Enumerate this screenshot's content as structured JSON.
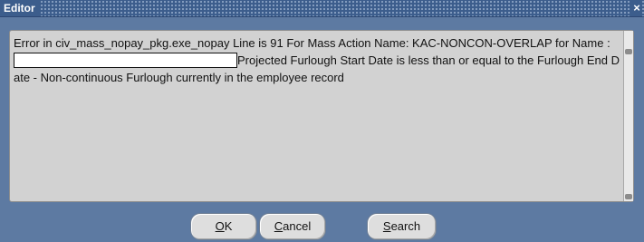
{
  "window": {
    "title": "Editor",
    "close_glyph": "×"
  },
  "editor": {
    "text_before": "Error in civ_mass_nopay_pkg.exe_nopay Line is 91  For Mass Action Name: KAC-NONCON-OVERLAP for Name : ",
    "name_value": "",
    "text_after": "Projected Furlough Start Date is less than or equal to the Furlough End Date - Non-continuous Furlough currently in the employee record"
  },
  "buttons": {
    "ok": {
      "mnemonic": "O",
      "rest": "K"
    },
    "cancel": {
      "mnemonic": "C",
      "rest": "ancel"
    },
    "search": {
      "mnemonic": "S",
      "rest": "earch"
    }
  },
  "icons": {
    "close": "close-icon",
    "scroll_up": "scroll-up-arrow-icon",
    "scroll_down": "scroll-down-arrow-icon"
  },
  "colors": {
    "titlebar": "#3c5d8c",
    "window_bg": "#5d7aa2",
    "text_panel": "#d2d2d2",
    "button_face": "#dedede"
  }
}
